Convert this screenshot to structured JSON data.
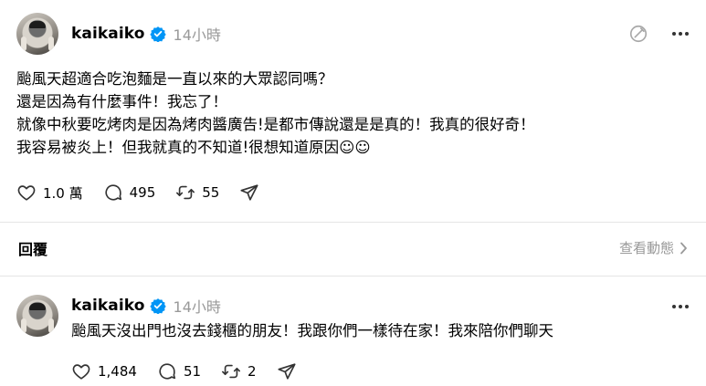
{
  "main_post": {
    "username": "kaikaiko",
    "timestamp": "14小時",
    "lines": [
      "颱風天超適合吃泡麵是一直以來的大眾認同嗎？",
      "還是因為有什麼事件！我忘了！",
      "就像中秋要吃烤肉是因為烤肉醬廣告!是都市傳說還是是真的！我真的很好奇！",
      "我容易被炎上！但我就真的不知道!很想知道原因☺☺"
    ],
    "likes": "1.0 萬",
    "comments": "495",
    "reposts": "55"
  },
  "replies_section": {
    "title": "回覆",
    "view_activity": "查看動態"
  },
  "reply_post": {
    "username": "kaikaiko",
    "timestamp": "14小時",
    "text": "颱風天沒出門也沒去錢櫃的朋友！我跟你們一樣待在家！我來陪你們聊天",
    "likes": "1,484",
    "comments": "51",
    "reposts": "2"
  },
  "icons": {
    "verified": "verified-badge-icon",
    "like": "heart-icon",
    "comment": "speech-bubble-icon",
    "repost": "repost-icon",
    "share": "send-icon",
    "more": "more-dots-icon",
    "no_activity": "slashed-circle-icon",
    "chevron": "chevron-right-icon"
  },
  "colors": {
    "verified_blue": "#0095f6",
    "muted_text": "#999999",
    "divider": "#e5e5e5"
  }
}
